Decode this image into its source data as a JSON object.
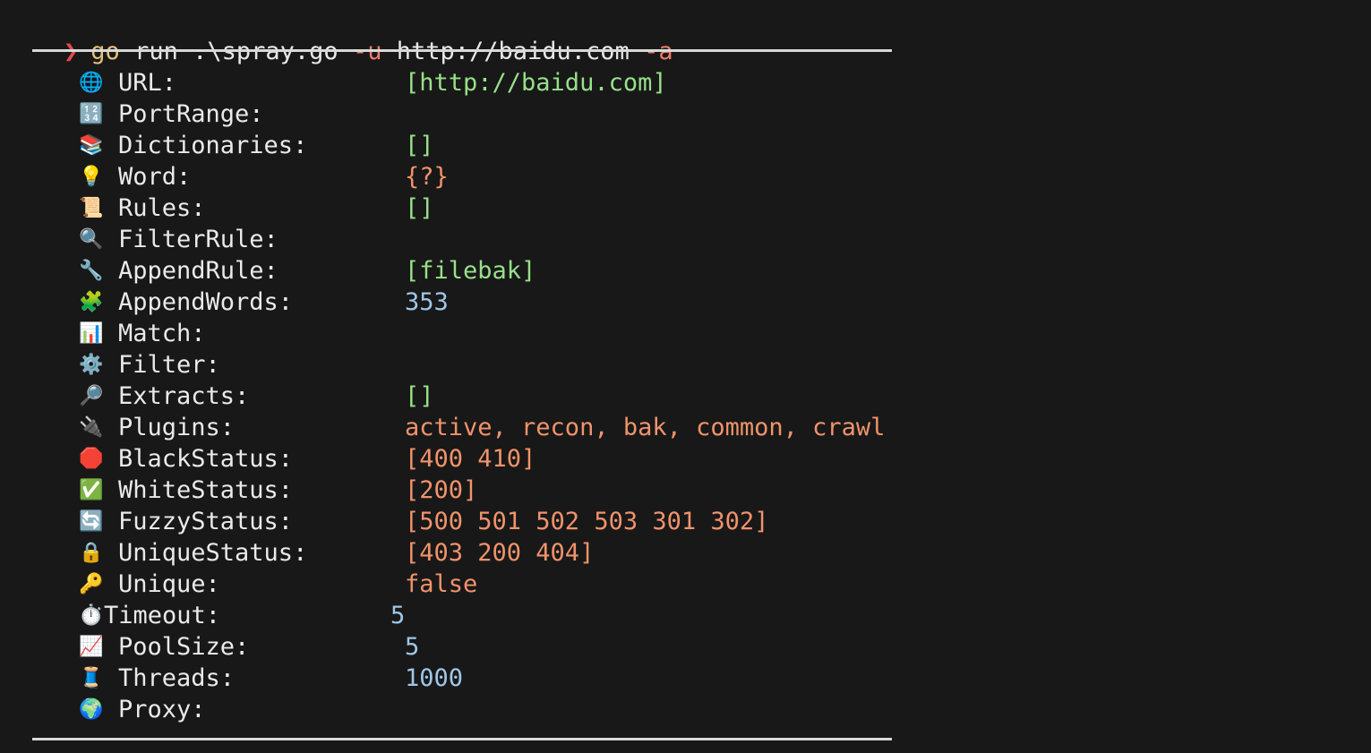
{
  "command": {
    "prompt_glyph": "❯",
    "program": "go",
    "subcommand": "run",
    "file": ".\\spray.go",
    "flag_u": "-u",
    "url": "http://baidu.com",
    "flag_a": "-a"
  },
  "rows": [
    {
      "icon": "🌐",
      "icon_name": "globe-icon",
      "label": "URL:",
      "value": "[http://baidu.com]",
      "color": "green"
    },
    {
      "icon": "🔢",
      "icon_name": "numbers-icon",
      "label": "PortRange:",
      "value": "",
      "color": "green"
    },
    {
      "icon": "📚",
      "icon_name": "books-icon",
      "label": "Dictionaries:",
      "value": "[]",
      "color": "green"
    },
    {
      "icon": "💡",
      "icon_name": "lightbulb-icon",
      "label": "Word:",
      "value": "{?}",
      "color": "orange"
    },
    {
      "icon": "📜",
      "icon_name": "scroll-icon",
      "label": "Rules:",
      "value": "[]",
      "color": "green"
    },
    {
      "icon": "🔍",
      "icon_name": "magnifier-icon",
      "label": "FilterRule:",
      "value": "",
      "color": "green"
    },
    {
      "icon": "🔧",
      "icon_name": "wrench-icon",
      "label": "AppendRule:",
      "value": "[filebak]",
      "color": "green"
    },
    {
      "icon": "🧩",
      "icon_name": "puzzle-icon",
      "label": "AppendWords:",
      "value": "353",
      "color": "blue"
    },
    {
      "icon": "📊",
      "icon_name": "bar-chart-icon",
      "label": "Match:",
      "value": "",
      "color": "green"
    },
    {
      "icon": "⚙️",
      "icon_name": "gear-icon",
      "label": "Filter:",
      "value": "",
      "color": "green"
    },
    {
      "icon": "🔎",
      "icon_name": "magnifier-right-icon",
      "label": "Extracts:",
      "value": "[]",
      "color": "green"
    },
    {
      "icon": "🔌",
      "icon_name": "plug-icon",
      "label": "Plugins:",
      "value": "active, recon, bak, common, crawl",
      "color": "orange"
    },
    {
      "icon": "🛑",
      "icon_name": "stop-sign-icon",
      "label": "BlackStatus:",
      "value": "[400 410]",
      "color": "orange"
    },
    {
      "icon": "✅",
      "icon_name": "check-mark-icon",
      "label": "WhiteStatus:",
      "value": "[200]",
      "color": "orange"
    },
    {
      "icon": "🔄",
      "icon_name": "refresh-icon",
      "label": "FuzzyStatus:",
      "value": "[500 501 502 503 301 302]",
      "color": "orange"
    },
    {
      "icon": "🔒",
      "icon_name": "lock-icon",
      "label": "UniqueStatus:",
      "value": "[403 200 404]",
      "color": "orange"
    },
    {
      "icon": "🔑",
      "icon_name": "key-icon",
      "label": "Unique:",
      "value": "false",
      "color": "orange"
    },
    {
      "icon": "⏱️",
      "icon_name": "stopwatch-icon",
      "label": "Timeout:",
      "value": "5",
      "color": "blue",
      "shift": true
    },
    {
      "icon": "📈",
      "icon_name": "chart-increasing-icon",
      "label": "PoolSize:",
      "value": "5",
      "color": "blue"
    },
    {
      "icon": "🧵",
      "icon_name": "thread-icon",
      "label": "Threads:",
      "value": "1000",
      "color": "blue"
    },
    {
      "icon": "🌍",
      "icon_name": "earth-icon",
      "label": "Proxy:",
      "value": "",
      "color": "green"
    }
  ],
  "colors": {
    "background": "#181818",
    "green": "#98e08a",
    "orange": "#f0936b",
    "blue": "#9fc6e8",
    "prompt": "#e5484d",
    "go": "#e5c07b",
    "flag": "#f07b6b"
  }
}
